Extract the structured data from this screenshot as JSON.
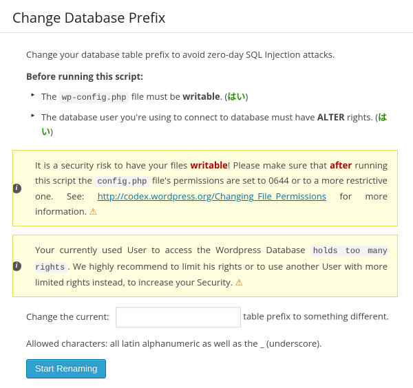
{
  "title": "Change Database Prefix",
  "intro": "Change your database table prefix to avoid zero-day SQL Injection attacks.",
  "before_label": "Before running this script:",
  "checks": {
    "item1": {
      "pre": "The ",
      "code": "wp-config.php",
      "post": " file must be ",
      "strong": "writable",
      "tail": ". (",
      "ok": "はい",
      "cap": ")"
    },
    "item2": {
      "pre": "The database user you're using to connect to database must have ",
      "strong": "ALTER",
      "post": " rights. (",
      "ok": "はい",
      "cap": ")"
    }
  },
  "notice1": {
    "t1": "It is a security risk to have your files ",
    "w1": "writable",
    "t2": "! Please make sure that ",
    "w2": "after",
    "t3": " running this script the ",
    "code1": "config.php",
    "t4": " file's permissions are set to 0644 or to a more restrictive one. See: ",
    "link": "http://codex.wordpress.org/Changing_File_Permissions",
    "t5": " for more information. "
  },
  "notice2": {
    "t1": "Your currently used User to access the Wordpress Database ",
    "code1": "holds too many rights",
    "t2": ". We highly recommend to limit his rights or to use another User with more limited rights instead, to increase your Security. "
  },
  "form": {
    "label_pre": "Change the current:",
    "placeholder": "",
    "value": "",
    "label_post": "table prefix to something different."
  },
  "allowed_note": "Allowed characters: all latin alphanumeric as well as the _ (underscore).",
  "button": "Start Renaming"
}
